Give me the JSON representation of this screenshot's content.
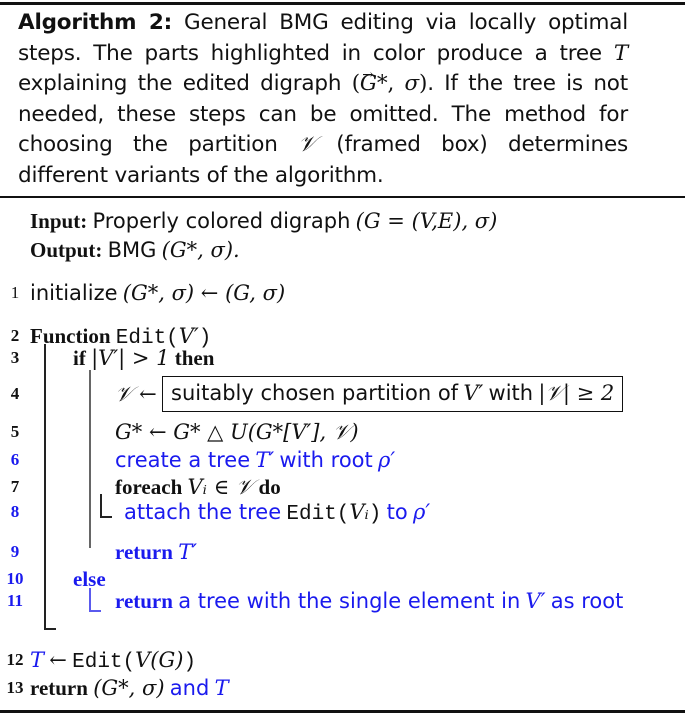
{
  "algorithm": {
    "label": "Algorithm 2:",
    "caption_lines": [
      "General BMG editing via locally optimal",
      "steps. The parts highlighted in color produce a tree",
      "explaining the edited digraph",
      ". If the tree is",
      "not needed, these steps can be omitted. The method",
      "for choosing the partition",
      "(framed box) determines",
      "different variants of the algorithm."
    ],
    "symbols": {
      "T": "T",
      "G": "G",
      "G_star": "G*",
      "sigma": "σ",
      "V_cal": "𝒱",
      "V_prime": "V′",
      "T_prime": "T′",
      "rho_prime": "ρ′",
      "V_i": "Vᵢ"
    },
    "input_label": "Input:",
    "input_text": "Properly colored digraph",
    "input_math": "(G = (V,E), σ)",
    "output_label": "Output:",
    "output_text": "BMG",
    "output_math": "(G*, σ).",
    "highlight_color": "#1a1aee",
    "lines": [
      {
        "num": "1",
        "highlighted": false,
        "text": "initialize",
        "math": "(G*, σ) ← (G, σ)"
      },
      {
        "num": "2",
        "highlighted": false,
        "keyword": "Function",
        "code": "Edit(",
        "math": "V′",
        "code_end": ")"
      },
      {
        "num": "3",
        "highlighted": false,
        "keyword": "if",
        "math": "|V′| > 1",
        "keyword_end": "then"
      },
      {
        "num": "4",
        "highlighted": false,
        "math": "𝒱 ←",
        "boxed_text": "suitably chosen partition of",
        "boxed_math1": "V′",
        "boxed_text2": "with",
        "boxed_math2": "|𝒱| ≥ 2"
      },
      {
        "num": "5",
        "highlighted": false,
        "math": "G* ← G* △ U(G*[V′], 𝒱)"
      },
      {
        "num": "6",
        "highlighted": true,
        "text": "create a tree",
        "math1": "T′",
        "text2": "with root",
        "math2": "ρ′"
      },
      {
        "num": "7",
        "highlighted": false,
        "keyword": "foreach",
        "math": "Vᵢ ∈ 𝒱",
        "keyword_end": "do"
      },
      {
        "num": "8",
        "highlighted": true,
        "text": "attach the tree",
        "code": "Edit(",
        "math": "Vᵢ",
        "code_end": ")",
        "text2": "to",
        "math2": "ρ′"
      },
      {
        "num": "9",
        "highlighted": true,
        "keyword": "return",
        "math": "T′"
      },
      {
        "num": "10",
        "highlighted": true,
        "keyword": "else"
      },
      {
        "num": "11",
        "highlighted": true,
        "keyword": "return",
        "text": "a tree with the single element in",
        "math": "V′",
        "text2": "as root"
      },
      {
        "num": "12",
        "highlighted": true,
        "math": "T",
        "arrow": "←",
        "code": "Edit(",
        "math2": "V(G)",
        "code_end": ")"
      },
      {
        "num": "13",
        "highlighted": false,
        "keyword": "return",
        "math": "(G*, σ)",
        "text": "and",
        "math2": "T"
      }
    ]
  }
}
